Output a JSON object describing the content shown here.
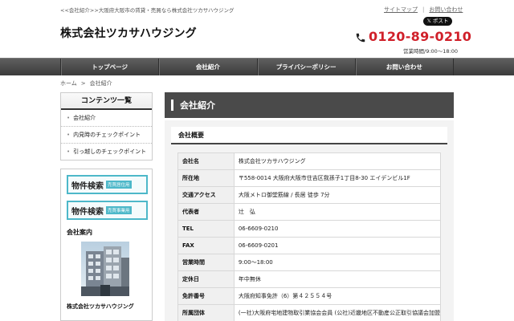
{
  "header": {
    "tagline": "<<会社紹介>>大阪府大阪市の賃貸・売買なら株式会社ツカサハウジング",
    "links": [
      "サイトマップ",
      "お問い合わせ"
    ],
    "x_post_label": "𝕏 ポスト",
    "logo": "株式会社ツカサハウジング",
    "phone": "0120-89-0210",
    "hours": "営業時間/9:00～18:00"
  },
  "nav": [
    "トップページ",
    "会社紹介",
    "プライバシーポリシー",
    "お問い合わせ"
  ],
  "breadcrumb": {
    "home": "ホーム",
    "arrow": ">",
    "current": "会社紹介"
  },
  "sidebar": {
    "contents_title": "コンテンツ一覧",
    "contents": [
      "会社紹介",
      "内見時のチェックポイント",
      "引っ越しのチェックポイント"
    ],
    "banners": [
      {
        "big": "物件検索",
        "tag": "売買居住用"
      },
      {
        "big": "物件検索",
        "tag": "売買事業用"
      }
    ],
    "info_title": "会社案内",
    "company_name": "株式会社ツカサハウジング"
  },
  "content": {
    "title": "会社紹介",
    "section_title": "会社概要",
    "rows": [
      {
        "label": "会社名",
        "value": "株式会社ツカサハウジング"
      },
      {
        "label": "所在地",
        "value": "〒558-0014 大阪府大阪市住吉区我孫子1丁目8-30 エイデンビル1F"
      },
      {
        "label": "交通アクセス",
        "value": "大阪メトロ御堂筋線 / 長居 徒歩 7分"
      },
      {
        "label": "代表者",
        "value": "辻　弘"
      },
      {
        "label": "TEL",
        "value": "06-6609-0210"
      },
      {
        "label": "FAX",
        "value": "06-6609-0201"
      },
      {
        "label": "営業時間",
        "value": "9:00～18:00"
      },
      {
        "label": "定休日",
        "value": "年中無休"
      },
      {
        "label": "免許番号",
        "value": "大阪府知事免許（6）第４２５５４号"
      },
      {
        "label": "所属団体",
        "value": "(一社)大阪府宅地建物取引業協会会員 (公社)近畿地区不動産公正取引協議会加盟"
      }
    ]
  },
  "colors": {
    "accent_red": "#d0202a",
    "nav_dark": "#4a4a4a",
    "banner_teal": "#4db8c9"
  },
  "icons": {
    "phone": "phone-icon",
    "x_logo": "x-logo-icon"
  }
}
